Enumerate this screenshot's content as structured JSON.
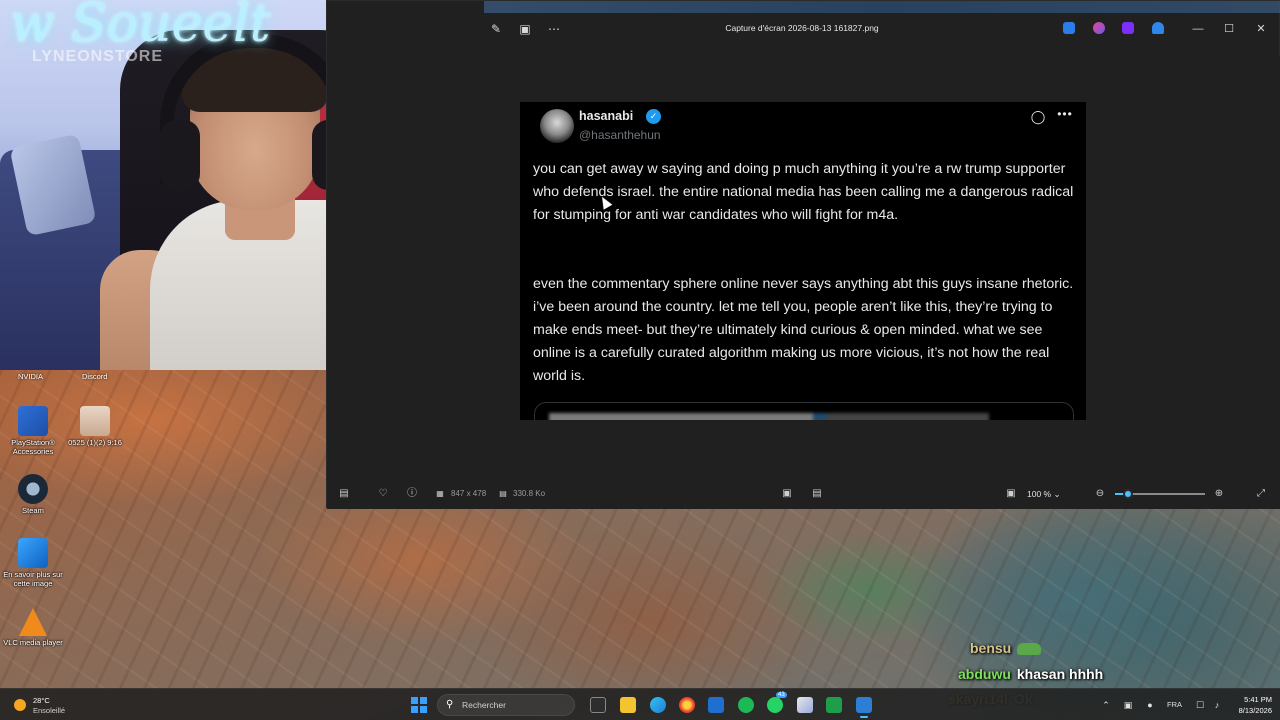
{
  "webcam": {
    "sign_text": "Soueelt",
    "sign_prefix": "w",
    "sub_text": "LYNEONSTORE"
  },
  "desktop": {
    "top_labels": [
      "NVIDIA",
      "Discord"
    ],
    "icons": [
      {
        "label": "PlayStation® Accessories",
        "icon": "playstation-icon"
      },
      {
        "label": "0525 (1)(2) 9:16",
        "icon": "image-thumbnail-icon"
      },
      {
        "label": "Steam",
        "icon": "steam-icon"
      },
      {
        "label": "En savoir plus sur cette image",
        "icon": "spotlight-info-icon"
      },
      {
        "label": "VLC media player",
        "icon": "vlc-icon"
      }
    ]
  },
  "photos": {
    "title": "Capture d'écran 2026-08-13 161827.png",
    "left_tools": [
      "edit-icon",
      "slideshow-icon",
      "more-icon"
    ],
    "app_icons": [
      "bing-icon",
      "copilot-icon",
      "clipchamp-icon",
      "cloud-icon"
    ],
    "window_controls": [
      "minimize-icon",
      "maximize-icon",
      "close-icon"
    ],
    "bottom": {
      "dimensions": "847 x 478",
      "file_size": "330.8 Ko",
      "zoom": "100 %",
      "zoom_level_fraction": 0.14
    }
  },
  "tweet": {
    "name": "hasanabi",
    "handle": "@hasanthehun",
    "paragraph1": "you can get away w saying and doing p much anything it you’re a rw trump supporter who defends israel. the entire national media has been calling me a dangerous radical for stumping for anti war candidates who will fight for m4a.",
    "paragraph2": "even the commentary sphere online never says anything abt this guys insane rhetoric. i’ve been around the country. let me tell you, people aren’t like this, they’re trying to make ends meet- but they’re ultimately kind curious & open minded. what we see online is a carefully curated algorithm making us more vicious, it’s not how the real world is."
  },
  "chat": [
    {
      "user": "bensu",
      "message": ""
    },
    {
      "user": "abduwu",
      "message": "khasan hhhh"
    },
    {
      "user": "skayri14l",
      "message": "Ok"
    }
  ],
  "taskbar": {
    "weather_temp": "28°C",
    "weather_desc": "Ensoleillé",
    "search_placeholder": "Rechercher",
    "language": "FRA",
    "time": "5:41 PM",
    "date": "8/13/2026",
    "badge": "43"
  }
}
